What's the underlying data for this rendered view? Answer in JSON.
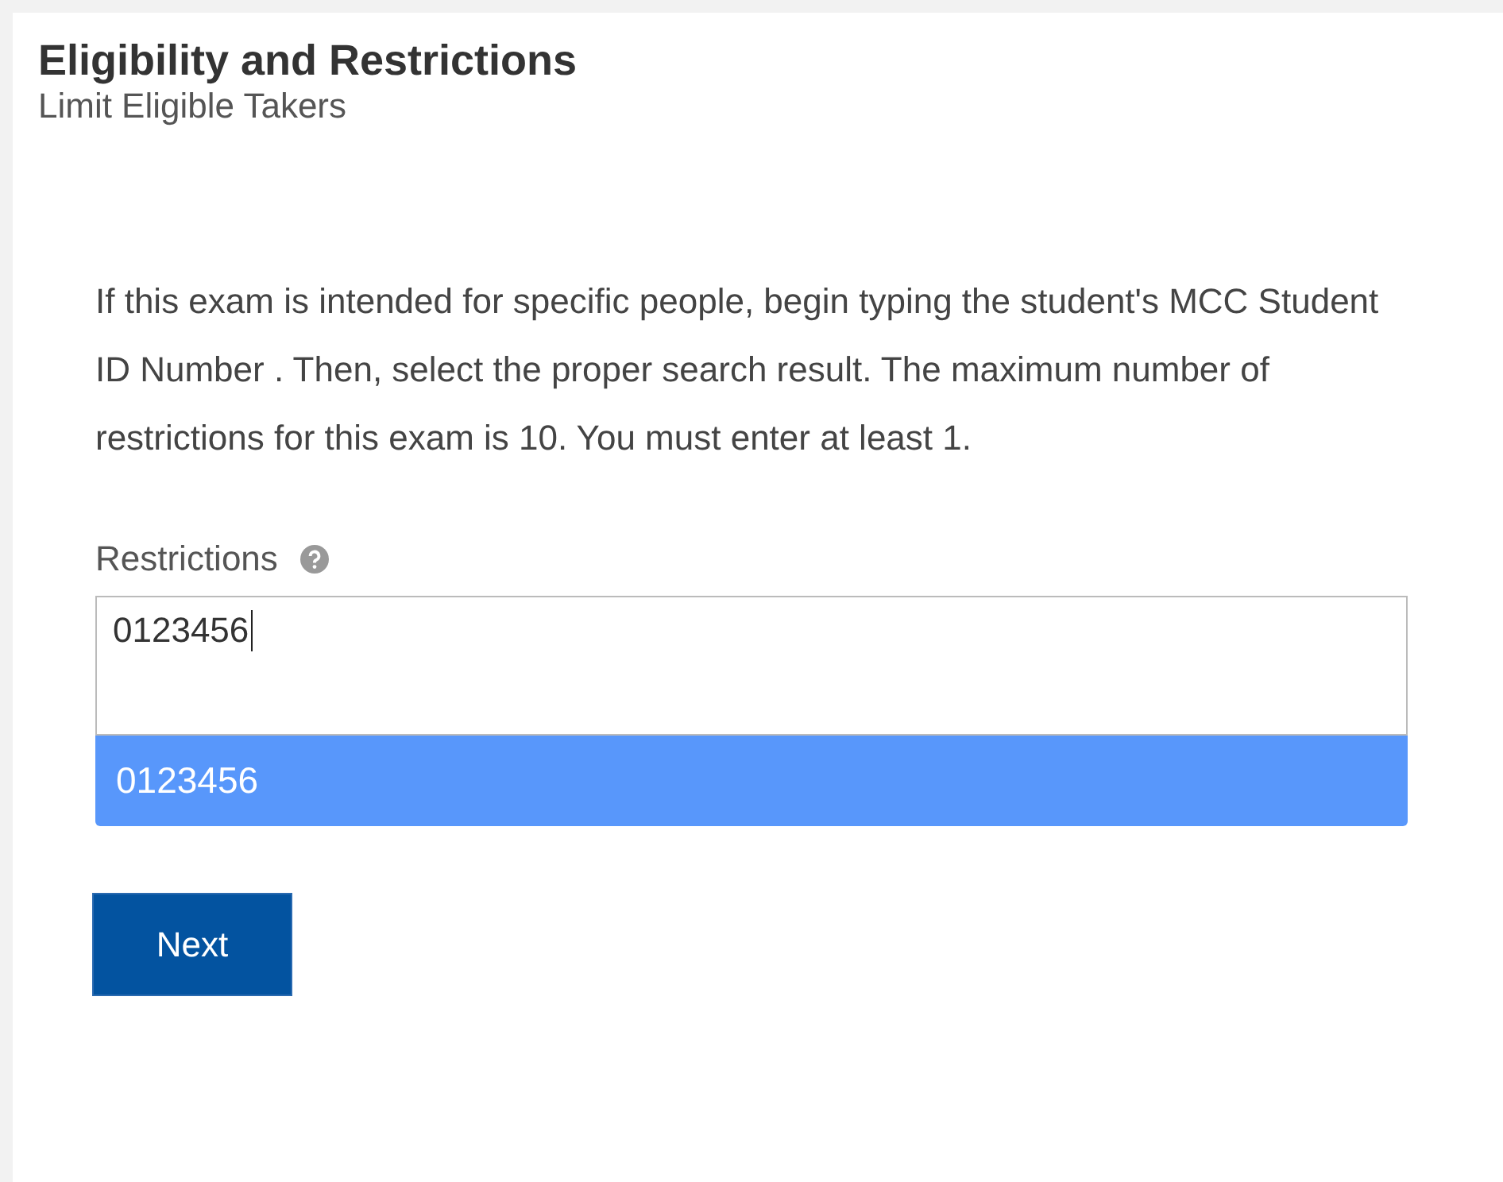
{
  "header": {
    "title": "Eligibility and Restrictions",
    "subtitle": "Limit Eligible Takers"
  },
  "instructions": "If this exam is intended for specific people, begin typing the student's MCC Student ID Number . Then, select the proper search result. The maximum number of restrictions for this exam is 10. You must enter at least 1.",
  "restrictions": {
    "label": "Restrictions",
    "value": "0123456",
    "suggestions": [
      {
        "label": "0123456",
        "selected": true
      }
    ]
  },
  "buttons": [
    {
      "label": "Next"
    }
  ]
}
